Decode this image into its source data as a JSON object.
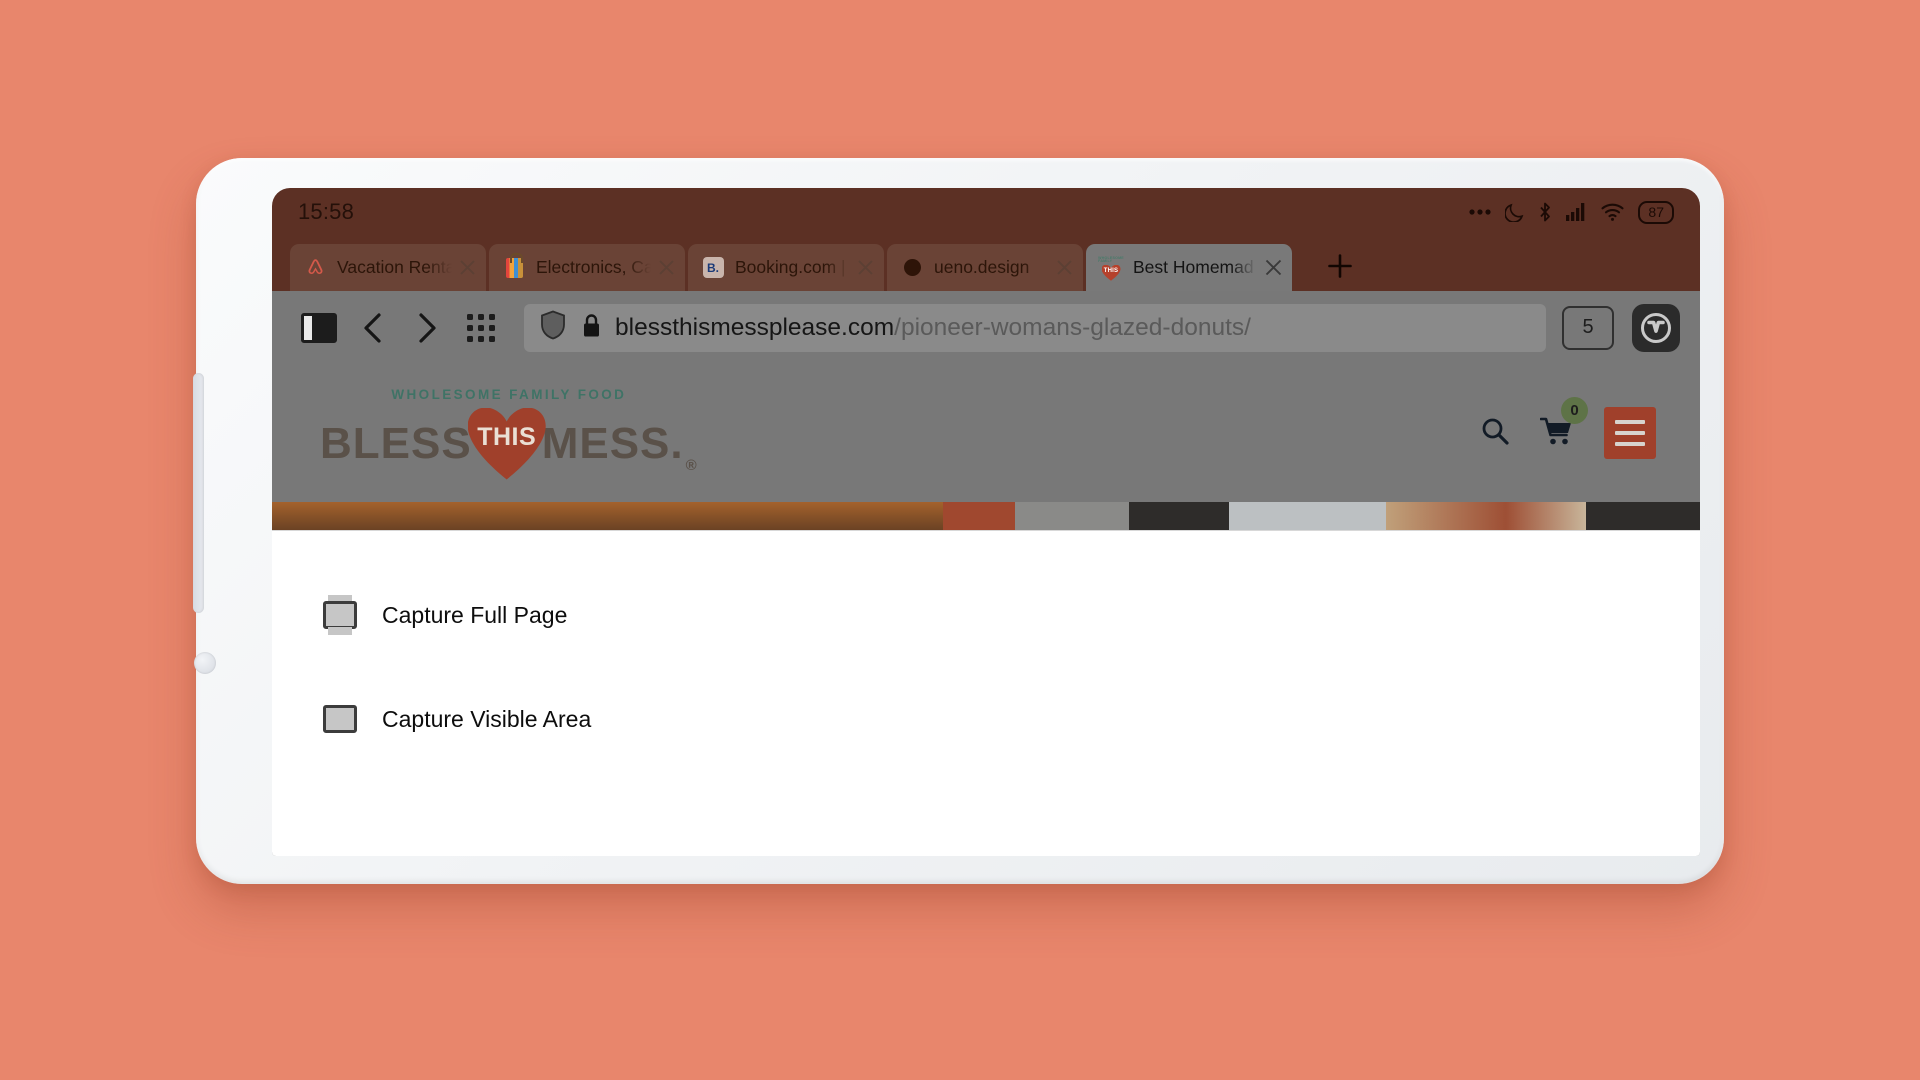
{
  "device": {
    "name": "tablet-device",
    "side_buttons": [
      "volume-rocker",
      "power-button"
    ]
  },
  "status_bar": {
    "clock": "15:58",
    "battery_level": "87",
    "icons": [
      "more-options-icon",
      "do-not-disturb-moon-icon",
      "bluetooth-icon",
      "cellular-signal-icon",
      "wifi-icon",
      "battery-icon"
    ],
    "background_color": "#5C3024"
  },
  "tabs": {
    "new_tab_label": "+",
    "close_label": "×",
    "items": [
      {
        "title": "Vacation Renta",
        "favicon": "airbnb-icon",
        "active": false
      },
      {
        "title": "Electronics, Ca",
        "favicon": "shopping-bag-icon",
        "active": false
      },
      {
        "title": "Booking.com |",
        "favicon": "booking-b-icon",
        "active": false
      },
      {
        "title": "ueno.design",
        "favicon": "dark-circle-icon",
        "active": false
      },
      {
        "title": "Best Homemad",
        "favicon": "bless-this-mess-icon",
        "active": true
      }
    ]
  },
  "toolbar": {
    "panel_toggle_label": "panel-toggle",
    "back_label": "back",
    "forward_label": "forward",
    "speed_dial_label": "speed-dial",
    "shield_label": "tracker-blocker",
    "lock_label": "secure-connection",
    "url_domain": "blessthismessplease.com",
    "url_path": "/pioneer-womans-glazed-donuts/",
    "url_full": "blessthismessplease.com/pioneer-womans-glazed-donuts/",
    "tab_count": "5",
    "browser_logo_label": "Vivaldi",
    "background_color": "#787878"
  },
  "page": {
    "logo": {
      "kicker": "WHOLESOME FAMILY FOOD",
      "word_left": "BLESS",
      "heart_word": "THIS",
      "word_right": "MESS",
      "period": ".",
      "registered": "®",
      "kicker_color": "#3f7366",
      "heart_color": "#A0402B"
    },
    "actions": {
      "search_label": "search",
      "cart_label": "cart",
      "cart_count": "0",
      "cart_badge_color": "#5E7347",
      "menu_label": "menu",
      "menu_color": "#A0402B"
    }
  },
  "capture_menu": {
    "items": [
      {
        "label": "Capture Full Page",
        "icon": "capture-full-page-icon"
      },
      {
        "label": "Capture Visible Area",
        "icon": "capture-visible-area-icon"
      }
    ]
  },
  "theme": {
    "wallpaper_color": "#E8866C",
    "device_color": "#F1F3F5",
    "tab_bar_color": "#5C3024",
    "active_tab_color": "#797979"
  }
}
